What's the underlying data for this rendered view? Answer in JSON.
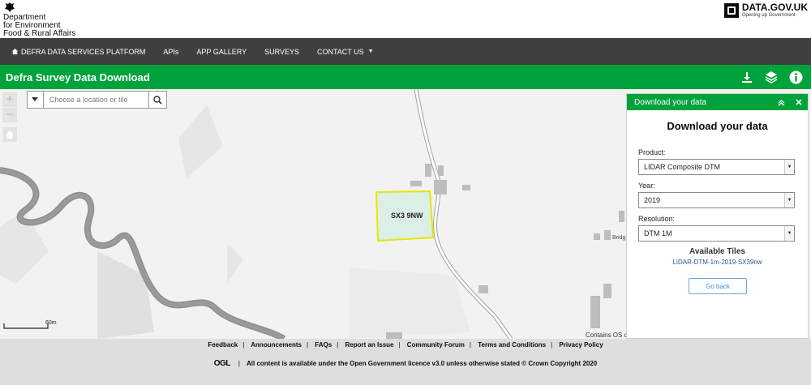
{
  "header": {
    "org_lines": [
      "Department",
      "for Environment",
      "Food & Rural Affairs"
    ],
    "datagov_name": "DATA.GOV.UK",
    "datagov_tagline": "Opening up Government"
  },
  "nav": {
    "items": [
      {
        "label": "DEFRA DATA SERVICES PLATFORM"
      },
      {
        "label": "APIs"
      },
      {
        "label": "APP GALLERY"
      },
      {
        "label": "SURVEYS"
      },
      {
        "label": "CONTACT US"
      }
    ]
  },
  "app": {
    "title": "Defra Survey Data Download",
    "icons": [
      "download-icon",
      "layers-icon",
      "info-icon"
    ]
  },
  "map": {
    "zoom_in": "+",
    "zoom_out": "−",
    "search_placeholder": "Choose a location or tile",
    "tile_label": "SX3 9NW",
    "place_label": "Bridg",
    "scale_label": "60m",
    "attribution": "Contains OS d"
  },
  "panel": {
    "header_title": "Download your data",
    "heading": "Download your data",
    "product_label": "Product:",
    "product_value": "LIDAR Composite DTM",
    "year_label": "Year:",
    "year_value": "2019",
    "resolution_label": "Resolution:",
    "resolution_value": "DTM 1M",
    "available_title": "Available Tiles",
    "available_tile": "LIDAR-DTM-1m-2019-SX39nw",
    "go_back": "Go back"
  },
  "footer": {
    "links": [
      "Feedback",
      "Announcements",
      "FAQs",
      "Report an Issue",
      "Community Forum",
      "Terms and Conditions",
      "Privacy Policy"
    ],
    "ogl": "OGL",
    "licence": "All content is available under the Open Government licence v3.0 unless otherwise stated © Crown Copyright 2020"
  },
  "colors": {
    "brand_green": "#00a33b",
    "nav_dark": "#3f3f3f",
    "tile_highlight": "#e6e600"
  }
}
